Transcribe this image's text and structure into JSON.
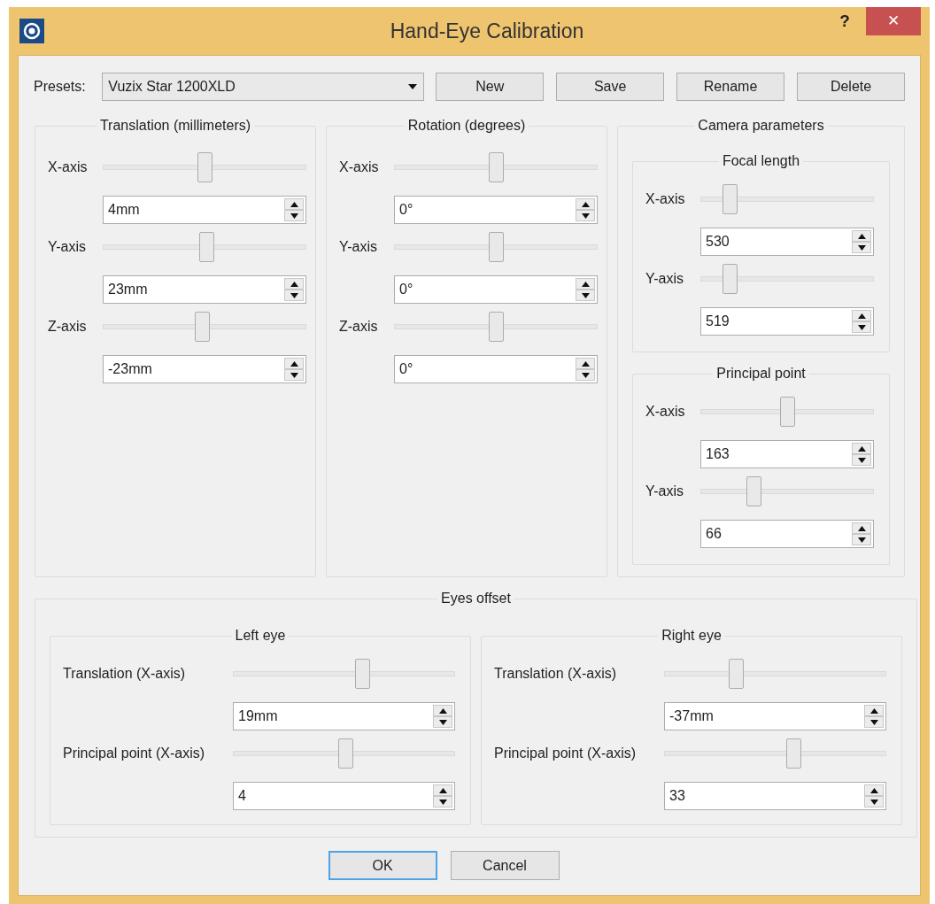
{
  "window": {
    "title": "Hand-Eye Calibration",
    "help_button": "?",
    "close_button": "✕"
  },
  "presets": {
    "label": "Presets:",
    "value": "Vuzix Star 1200XLD",
    "buttons": [
      "New",
      "Save",
      "Rename",
      "Delete"
    ]
  },
  "groups": [
    {
      "kind": "rows",
      "title": "Translation (millimeters)",
      "rows": [
        {
          "label": "X-axis",
          "level": 0.5,
          "value": "4mm"
        },
        {
          "label": "Y-axis",
          "level": 0.51,
          "value": "23mm"
        },
        {
          "label": "Z-axis",
          "level": 0.49,
          "value": "-23mm"
        }
      ]
    },
    {
      "kind": "rows",
      "title": "Rotation (degrees)",
      "rows": [
        {
          "label": "X-axis",
          "level": 0.5,
          "value": "0°"
        },
        {
          "label": "Y-axis",
          "level": 0.5,
          "value": "0°"
        },
        {
          "label": "Z-axis",
          "level": 0.5,
          "value": "0°"
        }
      ]
    },
    {
      "kind": "subgroups",
      "title": "Camera parameters",
      "subgroups": [
        {
          "title": "Focal length",
          "rows": [
            {
              "label": "X-axis",
              "level": 0.14,
              "value": "530"
            },
            {
              "label": "Y-axis",
              "level": 0.14,
              "value": "519"
            }
          ]
        },
        {
          "title": "Principal point",
          "rows": [
            {
              "label": "X-axis",
              "level": 0.5,
              "value": "163"
            },
            {
              "label": "Y-axis",
              "level": 0.29,
              "value": "66"
            }
          ]
        }
      ]
    }
  ],
  "eyes_offset": {
    "title": "Eyes offset",
    "subgroups": [
      {
        "title": "Left eye",
        "rows": [
          {
            "label": "Translation (X-axis)",
            "level": 0.59,
            "value": "19mm"
          },
          {
            "label": "Principal point (X-axis)",
            "level": 0.51,
            "value": "4"
          }
        ]
      },
      {
        "title": "Right eye",
        "rows": [
          {
            "label": "Translation (X-axis)",
            "level": 0.31,
            "value": "-37mm"
          },
          {
            "label": "Principal point (X-axis)",
            "level": 0.59,
            "value": "33"
          }
        ]
      }
    ]
  },
  "buttons": [
    {
      "label": "OK",
      "default": true
    },
    {
      "label": "Cancel",
      "default": false
    }
  ]
}
